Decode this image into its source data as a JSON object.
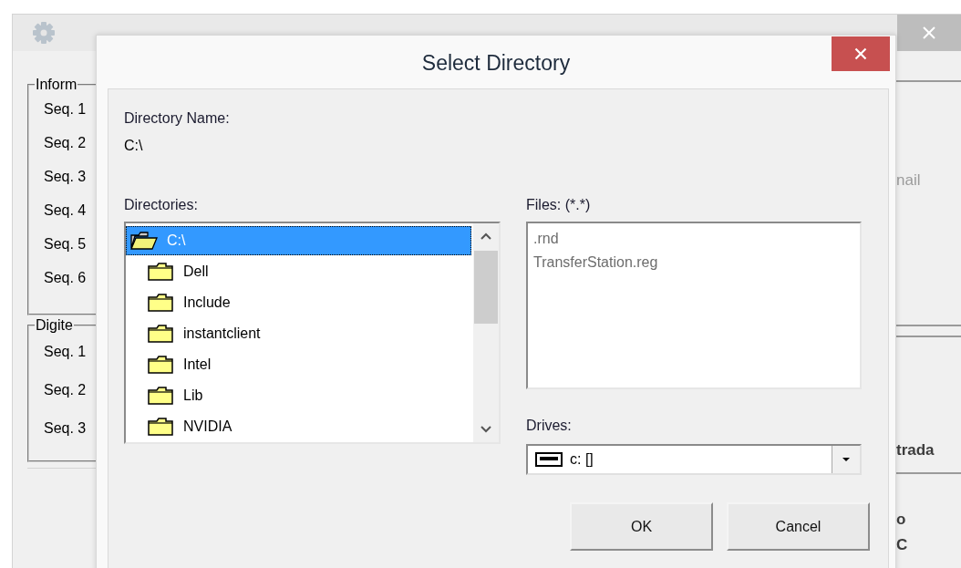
{
  "background_window": {
    "left_groups": [
      {
        "title": "Inform",
        "items": [
          "Seq. 1",
          "Seq. 2",
          "Seq. 3",
          "Seq. 4",
          "Seq. 5",
          "Seq. 6"
        ]
      },
      {
        "title": "Digite",
        "items": [
          "Seq. 1",
          "Seq. 2",
          "Seq. 3"
        ]
      }
    ],
    "right_sections": [
      {
        "texts": [
          {
            "text": "nail",
            "kind": "muted"
          }
        ]
      },
      {
        "texts": [
          {
            "text": "trada",
            "kind": "bold"
          }
        ]
      },
      {
        "texts": [
          {
            "text": "o",
            "kind": "bold"
          },
          {
            "text": "C",
            "kind": "bold"
          }
        ]
      }
    ]
  },
  "dialog": {
    "title": "Select Directory",
    "directory_name_label": "Directory Name:",
    "directory_name": "C:\\",
    "directories_label": "Directories:",
    "directories": [
      {
        "name": "C:\\",
        "kind": "open",
        "selected": true,
        "children": [
          {
            "name": "Dell",
            "kind": "closed",
            "selected": false
          },
          {
            "name": "Include",
            "kind": "closed",
            "selected": false
          },
          {
            "name": "instantclient",
            "kind": "closed",
            "selected": false
          },
          {
            "name": "Intel",
            "kind": "closed",
            "selected": false
          },
          {
            "name": "Lib",
            "kind": "closed",
            "selected": false
          },
          {
            "name": "NVIDIA",
            "kind": "closed",
            "selected": false
          }
        ]
      }
    ],
    "files_label": "Files: (*.*)",
    "files": [
      ".rnd",
      "TransferStation.reg"
    ],
    "drives_label": "Drives:",
    "drive": "c: []",
    "buttons": [
      "OK",
      "Cancel"
    ]
  }
}
